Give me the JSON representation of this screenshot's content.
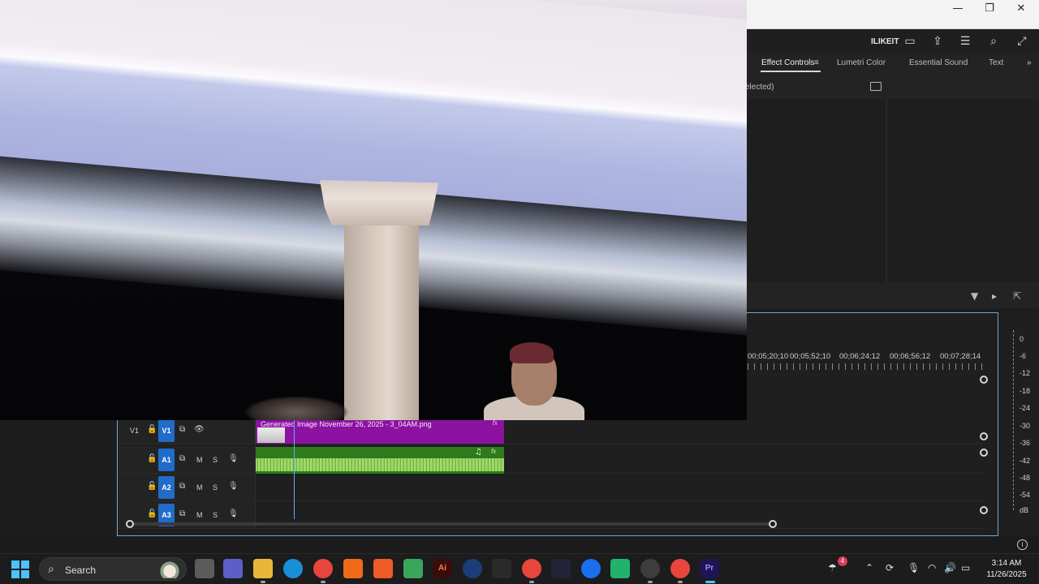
{
  "window": {
    "minimize_glyph": "—",
    "maximize_glyph": "❐",
    "close_glyph": "✕"
  },
  "header": {
    "workspace_label": "ILIKEIT"
  },
  "tabs": [
    {
      "label": "Effect Controls",
      "active": true
    },
    {
      "label": "Lumetri Color"
    },
    {
      "label": "Essential Sound"
    },
    {
      "label": "Text"
    }
  ],
  "effect_controls": {
    "header_text": "elected)"
  },
  "timeline": {
    "ruler": [
      "00;05;20;10",
      "00;05;52;10",
      "00;06;24;12",
      "00;06;56;12",
      "00;07;28;14"
    ],
    "tracks": [
      {
        "target": "V1",
        "label": "V1"
      },
      {
        "label": "A1",
        "m": "M",
        "s": "S"
      },
      {
        "label": "A2",
        "m": "M",
        "s": "S"
      },
      {
        "label": "A3",
        "m": "M",
        "s": "S"
      }
    ],
    "video_clip": {
      "title": "Generated Image November 26, 2025 - 3_04AM.png",
      "fx": "fx"
    },
    "audio_clip": {
      "fx": "fx"
    }
  },
  "meter": {
    "labels": [
      "0",
      "-6",
      "-12",
      "-18",
      "-24",
      "-30",
      "-36",
      "-42",
      "-48",
      "-54",
      "dB"
    ]
  },
  "taskbar": {
    "search_label": "Search",
    "notification_count": "4",
    "time": "3:14 AM",
    "date": "11/26/2025"
  },
  "colors": {
    "accent": "#1f6ccb",
    "video_clip": "#8c12a1",
    "audio_clip": "#2f7a1b",
    "playhead": "#5ab0ff"
  }
}
